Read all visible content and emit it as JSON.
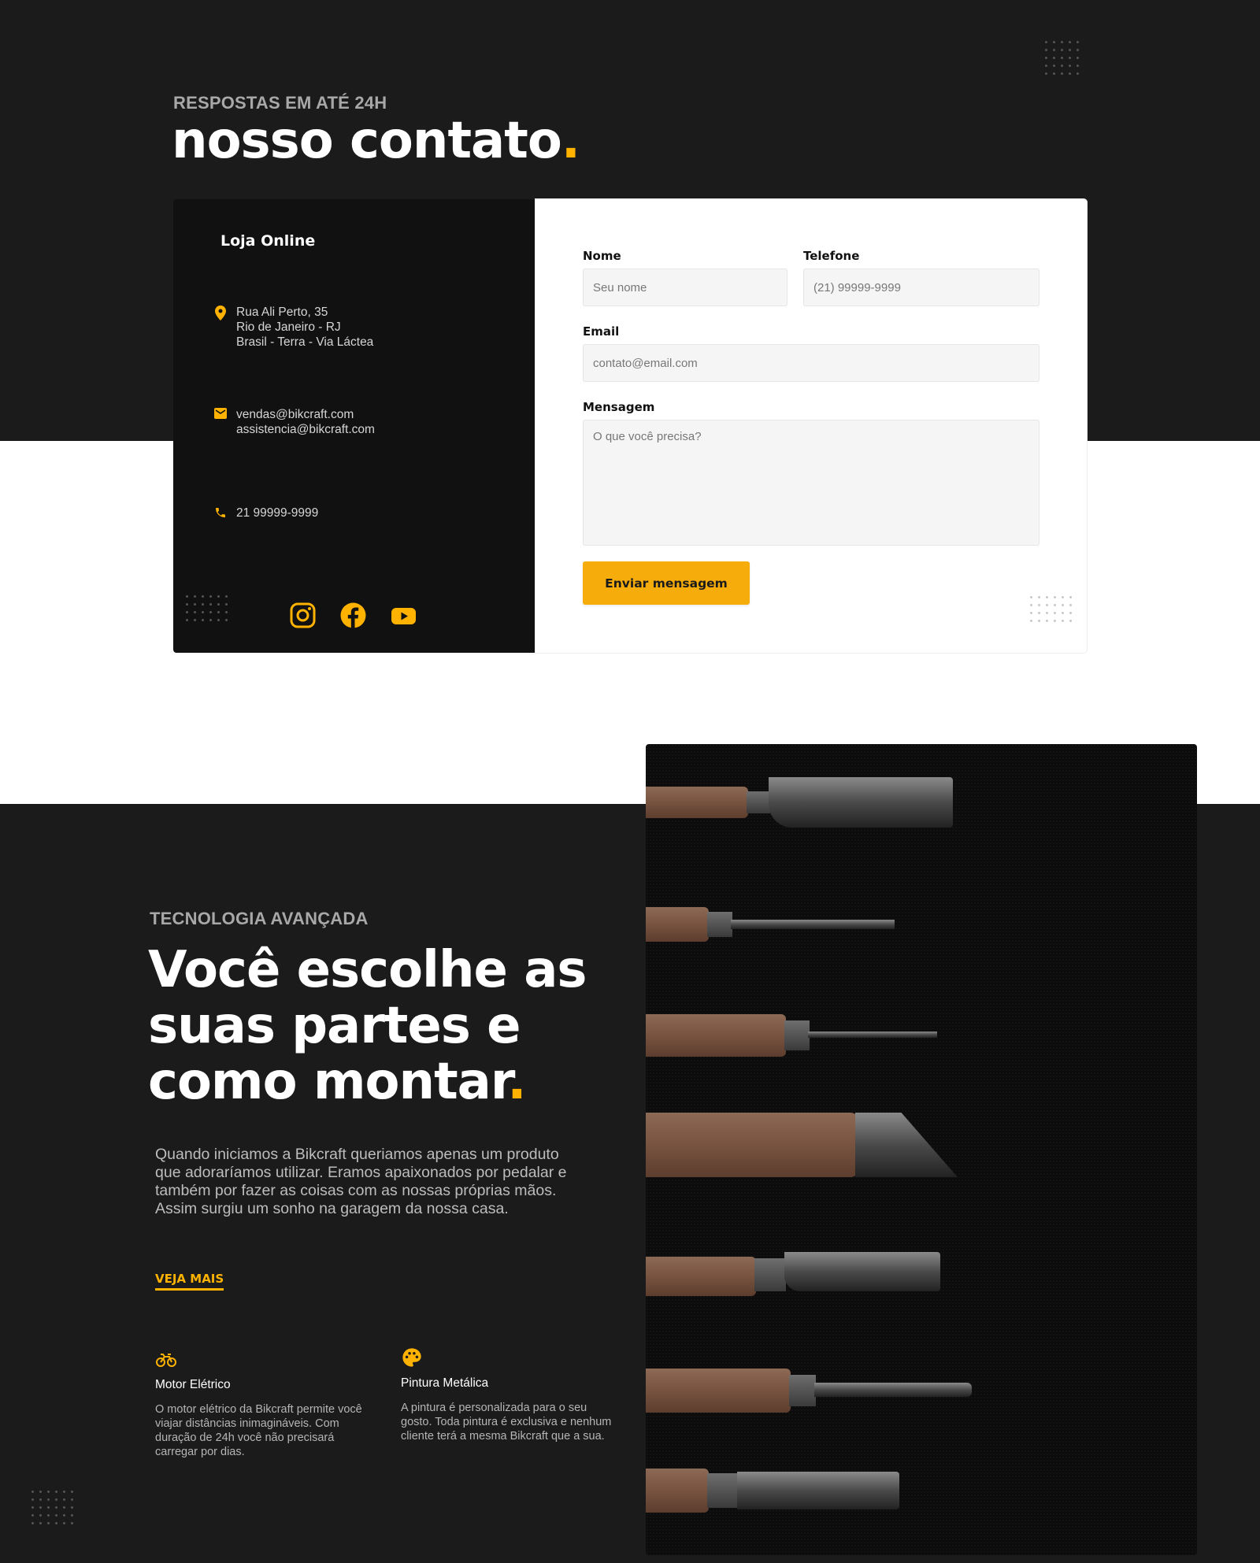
{
  "contact": {
    "eyebrow": "RESPOSTAS EM ATÉ 24H",
    "title": "nosso contato",
    "title_dot": ".",
    "card": {
      "store_title": "Loja Online",
      "address": [
        "Rua Ali Perto, 35",
        "Rio de Janeiro - RJ",
        "Brasil - Terra - Via Láctea"
      ],
      "emails": [
        "vendas@bikcraft.com",
        "assistencia@bikcraft.com"
      ],
      "phone": "21 99999-9999",
      "socials": [
        "instagram-icon",
        "facebook-icon",
        "youtube-icon"
      ]
    },
    "form": {
      "name_label": "Nome",
      "name_placeholder": "Seu nome",
      "phone_label": "Telefone",
      "phone_placeholder": "(21) 99999-9999",
      "email_label": "Email",
      "email_placeholder": "contato@email.com",
      "message_label": "Mensagem",
      "message_placeholder": "O que você precisa?",
      "submit_label": "Enviar mensagem"
    }
  },
  "technology": {
    "eyebrow": "TECNOLOGIA AVANÇADA",
    "title_lines": [
      "Você escolhe as",
      "suas partes e",
      "como montar"
    ],
    "title_dot": ".",
    "body": "Quando iniciamos a Bikcraft queriamos apenas um produto que adoraríamos utilizar. Eramos apaixonados por pedalar e também por fazer as coisas com as nossas próprias mãos. Assim surgiu um sonho na garagem da nossa casa.",
    "see_more": "VEJA MAIS",
    "features": [
      {
        "icon": "electric-bike-icon",
        "title": "Motor Elétrico",
        "text": "O motor elétrico da Bikcraft permite você viajar distâncias inimagináveis. Com duração de 24h você não precisará carregar por dias."
      },
      {
        "icon": "palette-icon",
        "title": "Pintura Metálica",
        "text": "A pintura é personalizada para o seu gosto. Toda pintura é exclusiva e nenhum cliente terá a mesma Bikcraft que a sua."
      }
    ]
  },
  "colors": {
    "accent": "#ffb300",
    "dark": "#1b1b1b",
    "card_dark": "#111111"
  }
}
